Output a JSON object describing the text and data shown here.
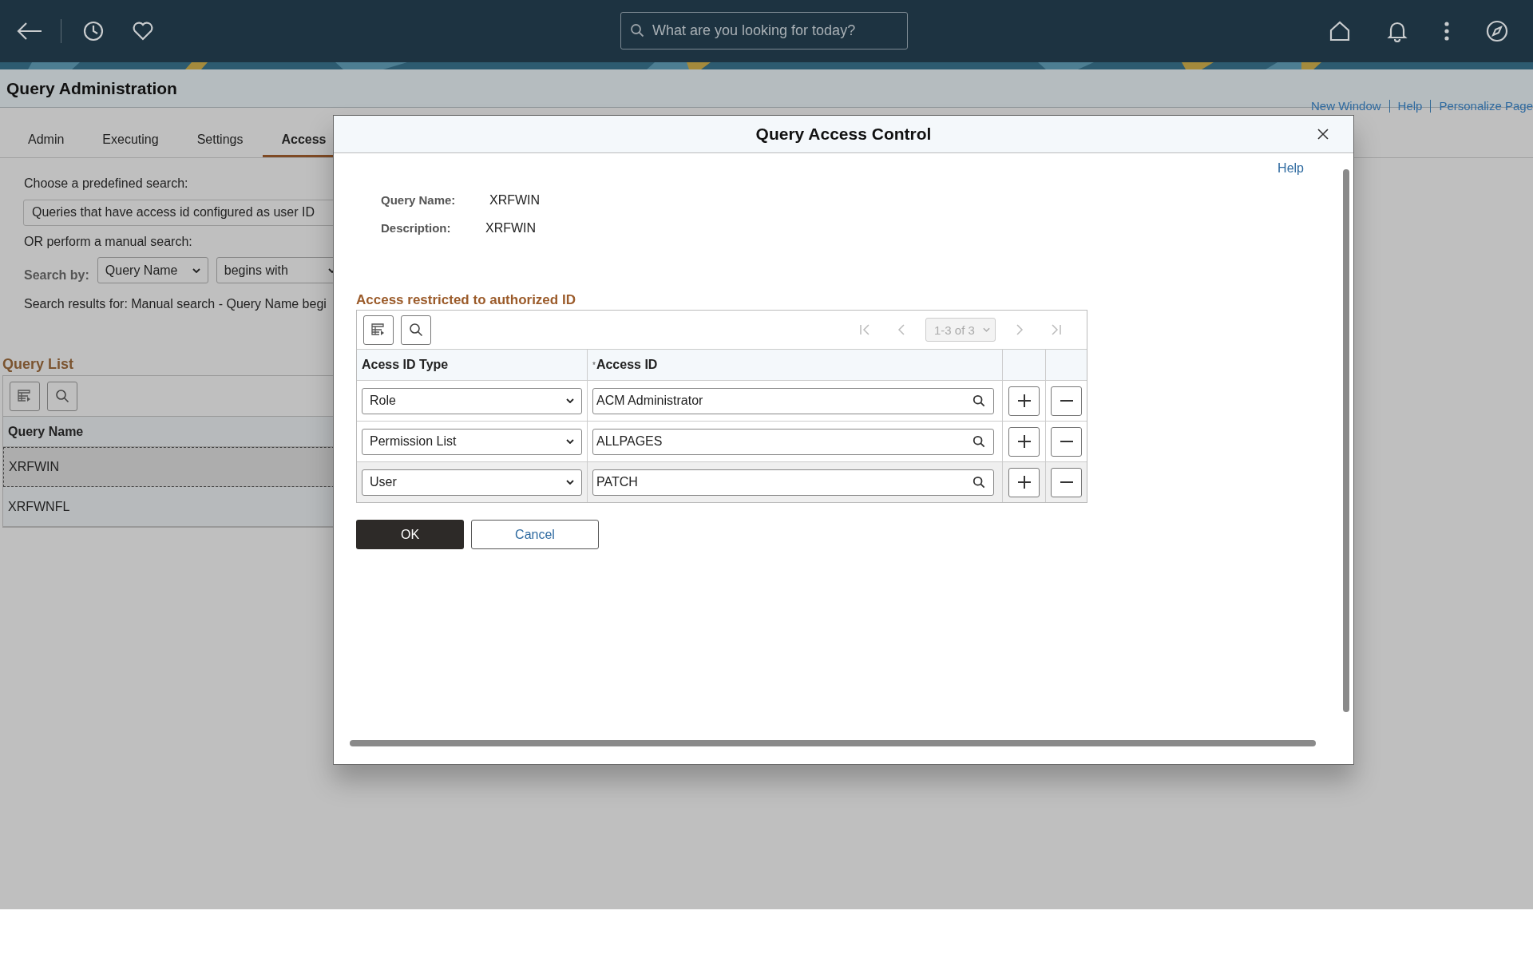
{
  "top_bar": {
    "search": {
      "placeholder": "What are you looking for today?"
    }
  },
  "page": {
    "title": "Query Administration",
    "links": [
      "New Window",
      "Help",
      "Personalize Page"
    ],
    "tabs": [
      {
        "label": "Admin",
        "selected": false
      },
      {
        "label": "Executing",
        "selected": false
      },
      {
        "label": "Settings",
        "selected": false
      },
      {
        "label": "Access",
        "selected": true
      }
    ],
    "predefined_label": "Choose a predefined search:",
    "predefined_value": "Queries that have access id configured as user ID",
    "manual_label": "OR perform a manual search:",
    "search_by": {
      "label": "Search by:",
      "field": "Query Name",
      "operator": "begins with"
    },
    "results_text": "Search results for: Manual search - Query Name begi",
    "query_list": {
      "title": "Query List",
      "column": "Query Name",
      "rows": [
        {
          "name": "XRFWIN",
          "selected": true
        },
        {
          "name": "XRFWNFL",
          "selected": false
        }
      ]
    }
  },
  "modal": {
    "title": "Query Access Control",
    "help": "Help",
    "fields": [
      {
        "label": "Query Name:",
        "value": "XRFWIN"
      },
      {
        "label": "Description:",
        "value": "XRFWIN"
      }
    ],
    "section_title": "Access restricted to authorized ID",
    "pagination": "1-3 of 3",
    "columns": [
      {
        "label": "Acess ID Type"
      },
      {
        "label": "Access ID",
        "marker": "*"
      }
    ],
    "rows": [
      {
        "type": "Role",
        "access_id": "ACM Administrator"
      },
      {
        "type": "Permission List",
        "access_id": "ALLPAGES"
      },
      {
        "type": "User",
        "access_id": "PATCH"
      }
    ],
    "buttons": {
      "ok": "OK",
      "cancel": "Cancel"
    }
  }
}
